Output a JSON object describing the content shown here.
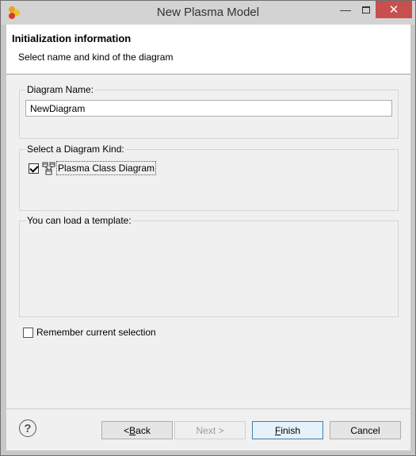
{
  "window": {
    "title": "New Plasma Model",
    "icons": {
      "app": "plasma-app-icon",
      "minimize": "minimize-icon",
      "maximize": "maximize-icon",
      "close": "close-icon"
    },
    "colors": {
      "close_bg": "#c7504f",
      "title_bar": "#d3d3d3"
    }
  },
  "header": {
    "title": "Initialization information",
    "subtitle": "Select name and kind of the diagram"
  },
  "diagram_name": {
    "label": "Diagram Name:",
    "value": "NewDiagram"
  },
  "diagram_kind": {
    "label": "Select a Diagram Kind:",
    "items": [
      {
        "label": "Plasma Class Diagram",
        "checked": true,
        "icon": "class-diagram-icon"
      }
    ]
  },
  "template": {
    "label": "You can load a template:"
  },
  "remember": {
    "label": "Remember current selection",
    "checked": false
  },
  "footer": {
    "help_icon": "help-icon",
    "back": {
      "prefix": "< ",
      "mnemonic": "B",
      "rest": "ack"
    },
    "next": "Next >",
    "finish": {
      "mnemonic": "F",
      "rest": "inish"
    },
    "cancel": "Cancel"
  }
}
